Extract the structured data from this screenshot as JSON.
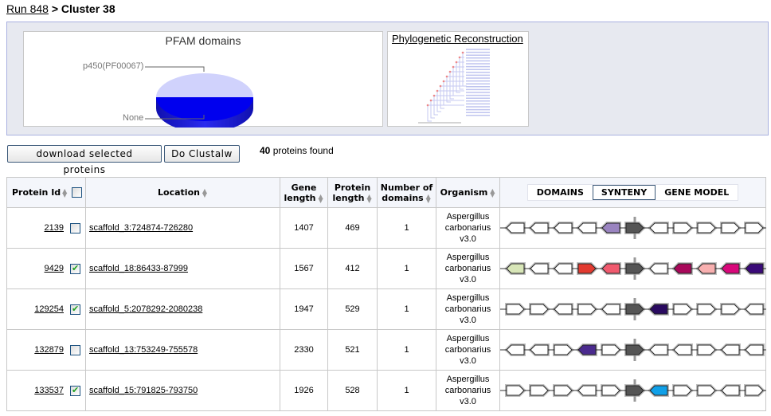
{
  "breadcrumb": {
    "parent": "Run 848",
    "separator": ">",
    "current": "Cluster 38"
  },
  "pfam_chart": {
    "title": "PFAM domains",
    "chart_data": {
      "type": "pie",
      "title": "PFAM domains",
      "slices": [
        {
          "label": "p450(PF00067)",
          "value": 50,
          "color": "#d0d2fc"
        },
        {
          "label": "None",
          "value": 50,
          "color": "#0000ee"
        }
      ]
    }
  },
  "phylo": {
    "link": "Phylogenetic Reconstruction"
  },
  "toolbar": {
    "download_label": "download selected proteins",
    "clustalw_label": "Do Clustalw",
    "count": "40",
    "count_suffix": " proteins found"
  },
  "table": {
    "headers": {
      "protein_id": "Protein Id",
      "location": "Location",
      "gene_length": [
        "Gene",
        "length"
      ],
      "protein_length": [
        "Protein",
        "length"
      ],
      "domains": [
        "Number of",
        "domains"
      ],
      "organism": "Organism"
    },
    "view_tabs": [
      {
        "label": "DOMAINS",
        "active": false
      },
      {
        "label": "SYNTENY",
        "active": true
      },
      {
        "label": "GENE MODEL",
        "active": false
      }
    ],
    "rows": [
      {
        "id": "2139",
        "checked": false,
        "location": "scaffold_3:724874-726280",
        "gene_length": "1407",
        "protein_length": "469",
        "domains": "1",
        "organism": [
          "Aspergillus",
          "carbonarius",
          "v3.0"
        ],
        "genes": [
          [
            "L",
            "#ffffff"
          ],
          [
            "L",
            "#ffffff"
          ],
          [
            "L",
            "#ffffff"
          ],
          [
            "L",
            "#ffffff"
          ],
          [
            "L",
            "#9a84c0"
          ],
          [
            "R",
            "#555555"
          ],
          [
            "L",
            "#ffffff"
          ],
          [
            "R",
            "#ffffff"
          ],
          [
            "R",
            "#ffffff"
          ],
          [
            "R",
            "#ffffff"
          ],
          [
            "R",
            "#ffffff"
          ]
        ]
      },
      {
        "id": "9429",
        "checked": true,
        "location": "scaffold_18:86433-87999",
        "gene_length": "1567",
        "protein_length": "412",
        "domains": "1",
        "organism": [
          "Aspergillus",
          "carbonarius",
          "v3.0"
        ],
        "genes": [
          [
            "L",
            "#d8e6b8"
          ],
          [
            "L",
            "#ffffff"
          ],
          [
            "L",
            "#ffffff"
          ],
          [
            "R",
            "#e23a30"
          ],
          [
            "L",
            "#f05a6e"
          ],
          [
            "R",
            "#555555"
          ],
          [
            "L",
            "#ffffff"
          ],
          [
            "L",
            "#a8085a"
          ],
          [
            "L",
            "#f8b0b0"
          ],
          [
            "L",
            "#d8087a"
          ],
          [
            "L",
            "#3a0a78"
          ]
        ]
      },
      {
        "id": "129254",
        "checked": true,
        "location": "scaffold_5:2078292-2080238",
        "gene_length": "1947",
        "protein_length": "529",
        "domains": "1",
        "organism": [
          "Aspergillus",
          "carbonarius",
          "v3.0"
        ],
        "genes": [
          [
            "R",
            "#ffffff"
          ],
          [
            "R",
            "#ffffff"
          ],
          [
            "L",
            "#ffffff"
          ],
          [
            "R",
            "#ffffff"
          ],
          [
            "L",
            "#ffffff"
          ],
          [
            "R",
            "#555555"
          ],
          [
            "L",
            "#2a0a60"
          ],
          [
            "R",
            "#ffffff"
          ],
          [
            "R",
            "#ffffff"
          ],
          [
            "R",
            "#ffffff"
          ],
          [
            "L",
            "#ffffff"
          ]
        ]
      },
      {
        "id": "132879",
        "checked": false,
        "location": "scaffold_13:753249-755578",
        "gene_length": "2330",
        "protein_length": "521",
        "domains": "1",
        "organism": [
          "Aspergillus",
          "carbonarius",
          "v3.0"
        ],
        "genes": [
          [
            "L",
            "#ffffff"
          ],
          [
            "L",
            "#ffffff"
          ],
          [
            "R",
            "#ffffff"
          ],
          [
            "L",
            "#4a2a8e"
          ],
          [
            "R",
            "#ffffff"
          ],
          [
            "R",
            "#555555"
          ],
          [
            "L",
            "#ffffff"
          ],
          [
            "L",
            "#ffffff"
          ],
          [
            "R",
            "#ffffff"
          ],
          [
            "L",
            "#ffffff"
          ],
          [
            "L",
            "#ffffff"
          ]
        ]
      },
      {
        "id": "133537",
        "checked": true,
        "location": "scaffold_15:791825-793750",
        "gene_length": "1926",
        "protein_length": "528",
        "domains": "1",
        "organism": [
          "Aspergillus",
          "carbonarius",
          "v3.0"
        ],
        "genes": [
          [
            "R",
            "#ffffff"
          ],
          [
            "R",
            "#ffffff"
          ],
          [
            "R",
            "#ffffff"
          ],
          [
            "L",
            "#ffffff"
          ],
          [
            "R",
            "#ffffff"
          ],
          [
            "R",
            "#555555"
          ],
          [
            "L",
            "#10a0e8"
          ],
          [
            "R",
            "#ffffff"
          ],
          [
            "R",
            "#ffffff"
          ],
          [
            "L",
            "#ffffff"
          ],
          [
            "R",
            "#ffffff"
          ]
        ]
      }
    ]
  }
}
